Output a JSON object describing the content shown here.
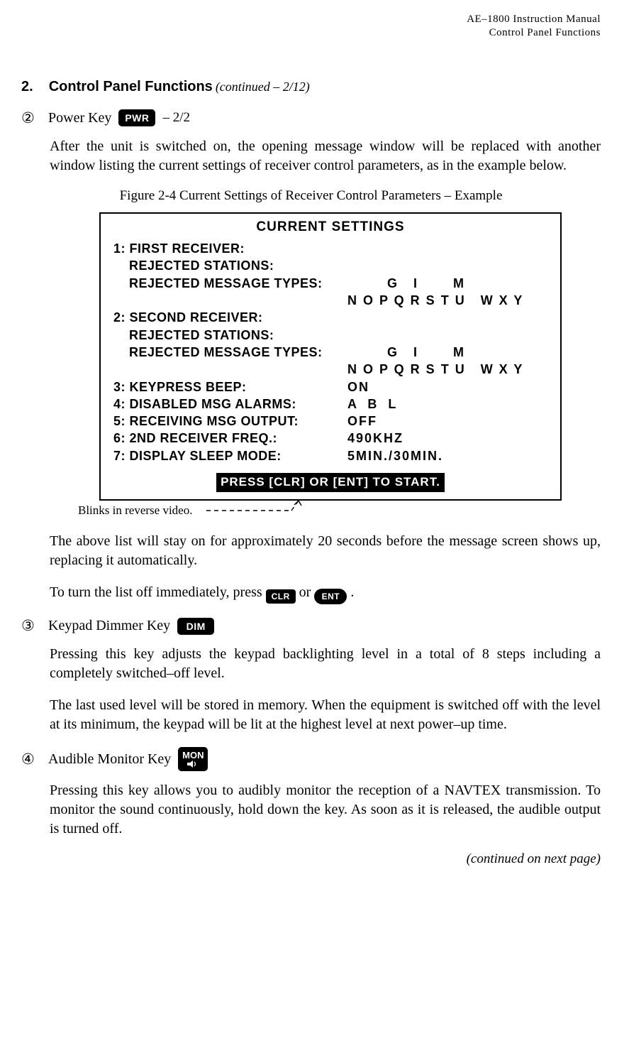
{
  "header": {
    "line1": "AE–1800 Instruction Manual",
    "line2": "Control  Panel  Functions"
  },
  "section": {
    "num": "2.",
    "title": "Control Panel Functions",
    "continued": "(continued – 2/12)"
  },
  "item2": {
    "circle": "②",
    "label": "Power Key",
    "badge": "PWR",
    "sub": " – 2/2",
    "para": "After the unit is switched on, the opening message window will be replaced with another window listing the current settings of receiver control parameters, as in the example below."
  },
  "figure": {
    "caption": "Figure 2-4 Current Settings of Receiver Control Parameters – Example"
  },
  "panel": {
    "title": "CURRENT SETTINGS",
    "r1_label": "1: FIRST RECEIVER:",
    "r1a_label": "    REJECTED STATIONS:",
    "r1b_label": "    REJECTED MESSAGE TYPES:",
    "r1b_val": "        G   I       M",
    "r1c_val": "N O P Q R S T U   W X Y",
    "r2_label": "2: SECOND RECEIVER:",
    "r2a_label": "    REJECTED STATIONS:",
    "r2b_label": "    REJECTED MESSAGE TYPES:",
    "r2b_val": "        G   I       M",
    "r2c_val": "N O P Q R S T U   W X Y",
    "r3_label": "3: KEYPRESS BEEP:",
    "r3_val": "ON",
    "r4_label": "4: DISABLED MSG ALARMS:",
    "r4_val": "A  B  L",
    "r5_label": "5: RECEIVING MSG OUTPUT:",
    "r5_val": "OFF",
    "r6_label": "6: 2ND RECEIVER FREQ.:",
    "r6_val": "490KHZ",
    "r7_label": "7: DISPLAY SLEEP MODE:",
    "r7_val": "5MIN./30MIN.",
    "footer": "PRESS [CLR] OR [ENT] TO START."
  },
  "blink_note": "Blinks in reverse video.",
  "after_panel_p1": "The above list will stay on for approximately 20 seconds before the message screen shows up, replacing it automatically.",
  "after_panel_p2_a": "To turn the list off immediately, press ",
  "key_clr": "CLR",
  "after_panel_p2_b": " or ",
  "key_ent": "ENT",
  "after_panel_p2_c": " .",
  "item3": {
    "circle": "③",
    "label": "Keypad Dimmer Key",
    "badge": "DIM",
    "para1": "Pressing this key adjusts the keypad backlighting level in a total of 8 steps including a completely switched–off level.",
    "para2": "The last used level will be stored in memory. When the equipment is switched off with the level at its minimum, the keypad will be lit at the highest level at next power–up time."
  },
  "item4": {
    "circle": "④",
    "label": "Audible Monitor Key",
    "badge": "MON",
    "para": "Pressing this key allows you to audibly monitor the reception of a NAVTEX transmission. To monitor the sound continuously, hold down the key. As soon as it is released, the audible output is turned off."
  },
  "foot_continued": "(continued on next page)"
}
